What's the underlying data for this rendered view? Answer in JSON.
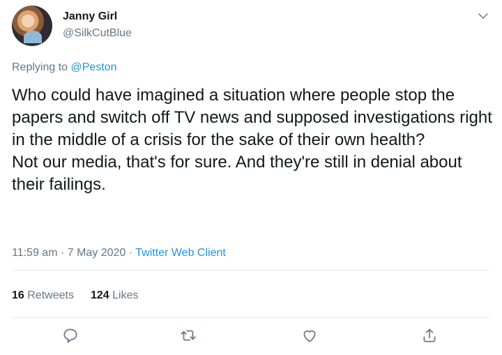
{
  "user": {
    "name": "Janny Girl",
    "handle": "@SilkCutBlue"
  },
  "replying": {
    "prefix": "Replying to ",
    "mention": "@Peston"
  },
  "tweet": {
    "text": "Who could have imagined a situation where people stop the papers and switch off TV news and supposed investigations right in the middle of a crisis for the sake of their own health?\nNot our media, that's for sure. And they're still in denial about their failings."
  },
  "meta": {
    "time": "11:59 am",
    "sep1": " · ",
    "date": "7 May 2020",
    "sep2": " · ",
    "client": "Twitter Web Client"
  },
  "stats": {
    "retweets_count": "16",
    "retweets_label": "Retweets",
    "likes_count": "124",
    "likes_label": "Likes"
  },
  "icons": {
    "more": "chevron-down-icon",
    "reply": "reply-icon",
    "retweet": "retweet-icon",
    "like": "heart-icon",
    "share": "share-icon"
  },
  "colors": {
    "link": "#1b95e0",
    "muted": "#657786",
    "text": "#14171a",
    "divider": "#e6ecf0"
  }
}
